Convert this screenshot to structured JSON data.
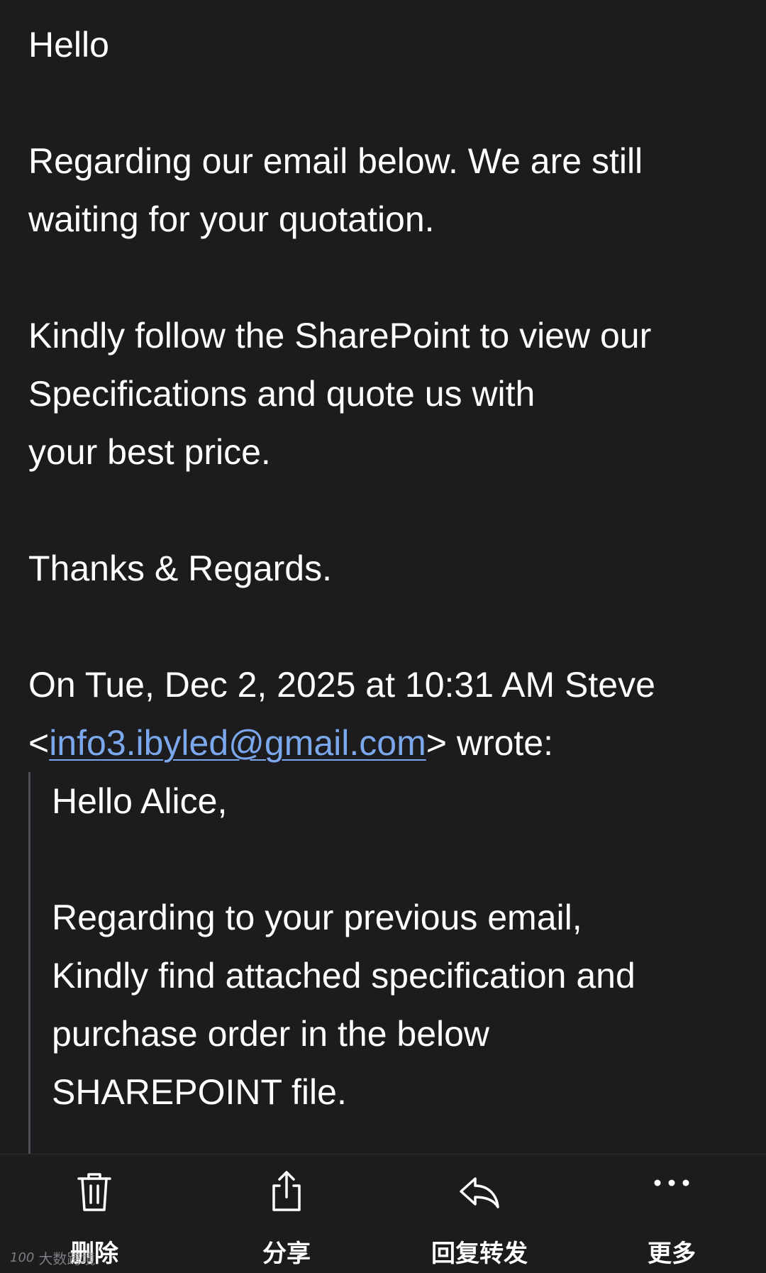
{
  "email": {
    "greeting": "Hello",
    "paragraph1": "Regarding our email below. We are still\nwaiting for your quotation.",
    "paragraph2": "Kindly follow the SharePoint to view our\nSpecifications and quote us with\nyour best price.",
    "closing": "Thanks & Regards.",
    "attribution_prefix": "On Tue, Dec 2, 2025 at 10:31 AM Steve <",
    "attribution_email": "info3.ibyled@gmail.com",
    "attribution_suffix": "> wrote:",
    "link_color": "#7ba7ec"
  },
  "quoted": {
    "greeting": "Hello Alice,",
    "paragraph1": "Regarding to your previous email,\nKindly find attached specification and\npurchase order in the below\nSHAREPOINT file."
  },
  "toolbar": {
    "delete": {
      "label": "删除",
      "icon": "trash-icon"
    },
    "share": {
      "label": "分享",
      "icon": "share-icon"
    },
    "reply_forward": {
      "label": "回复转发",
      "icon": "reply-icon"
    },
    "more": {
      "label": "更多",
      "icon": "ellipsis-icon"
    }
  },
  "watermark": {
    "logo": "100",
    "text": "大数跨境"
  }
}
